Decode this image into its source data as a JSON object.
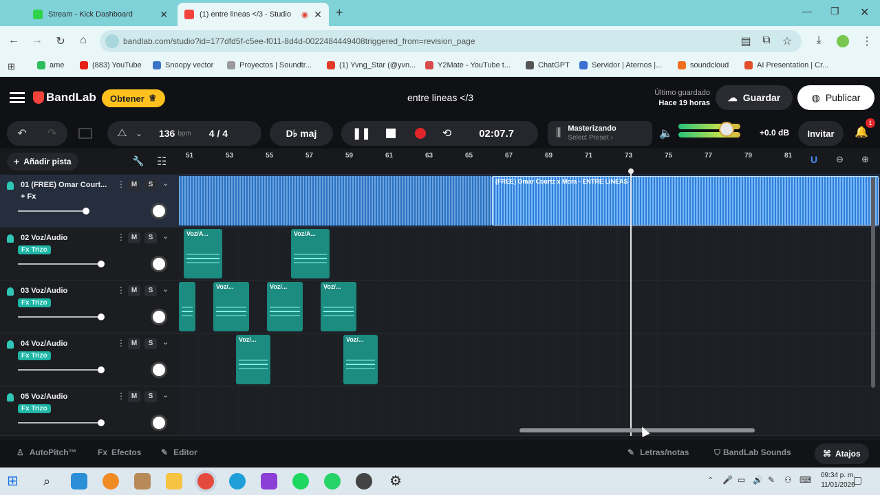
{
  "browser": {
    "tabs": [
      {
        "title": "Stream - Kick Dashboard",
        "color": "#2fd34a"
      },
      {
        "title": "(1) entre lineas </3 - Studio",
        "color": "#f2443b"
      }
    ],
    "new_tab": "+",
    "url": "bandlab.com/studio?id=177dfd5f-c5ee-f011-8d4d-0022484449408triggered_from=revision_page",
    "bookmarks": [
      {
        "label": "ame",
        "color": "#2fbf5a"
      },
      {
        "label": "(883) YouTube",
        "color": "#e62117"
      },
      {
        "label": "Snoopy vector",
        "color": "#3b74c6"
      },
      {
        "label": "Proyectos | Soundtr...",
        "color": "#9a9a9a"
      },
      {
        "label": "(1) Yvng_Star (@yvn...",
        "color": "#e23a2a"
      },
      {
        "label": "Y2Mate - YouTube t...",
        "color": "#d84a4a"
      },
      {
        "label": "ChatGPT",
        "color": "#555555"
      },
      {
        "label": "Servidor | Aternos |...",
        "color": "#3b6fd1"
      },
      {
        "label": "soundcloud",
        "color": "#f26f21"
      },
      {
        "label": "AI Presentation | Cr...",
        "color": "#e04e2a"
      }
    ]
  },
  "app": {
    "logo": "BandLab",
    "obtener": "Obtener",
    "project_title": "entre lineas </3",
    "saved_label": "Último guardado",
    "saved_time": "Hace 19 horas",
    "guardar": "Guardar",
    "publicar": "Publicar"
  },
  "transport": {
    "bpm": "136",
    "bpm_unit": "bpm",
    "time_signature": "4 / 4",
    "key": "D♭ maj",
    "position": "02:07.7",
    "mastering_title": "Masterizando",
    "mastering_sub": "Select Preset ›",
    "db": "+0.0 dB",
    "invitar": "Invitar",
    "notification_count": "1",
    "master_volume": 0.78
  },
  "tracks": {
    "add_track": "Añadir pista",
    "ruler": [
      "51",
      "53",
      "55",
      "57",
      "59",
      "61",
      "63",
      "65",
      "67",
      "69",
      "71",
      "73",
      "75",
      "77",
      "79",
      "81"
    ],
    "list": [
      {
        "name": "01 (FREE) Omar Court...",
        "fx": "+ Fx",
        "m": "M",
        "s": "S",
        "volume": 0.82
      },
      {
        "name": "02 Voz/Audio",
        "fx": "Fx Trizo",
        "m": "M",
        "s": "S",
        "volume": 0.98
      },
      {
        "name": "03 Voz/Audio",
        "fx": "Fx Trizo",
        "m": "M",
        "s": "S",
        "volume": 0.98
      },
      {
        "name": "04 Voz/Audio",
        "fx": "Fx Trizo",
        "m": "M",
        "s": "S",
        "volume": 0.98
      },
      {
        "name": "05 Voz/Audio",
        "fx": "Fx Trizo",
        "m": "M",
        "s": "S",
        "volume": 0.98
      }
    ],
    "beat_clip_label": "(FREE) Omar Courtz x Mora - ENTRE LINEAS",
    "vocal_clips": {
      "t2": [
        "Voz/A...",
        "Voz/A..."
      ],
      "t3": [
        "",
        "Voz/...",
        "Voz/...",
        "Voz/..."
      ],
      "t4": [
        "Voz/...",
        "Voz/..."
      ]
    }
  },
  "bottom": {
    "autopitch": "AutoPitch™",
    "efectos": "Efectos",
    "editor": "Editor",
    "letras": "Letras/notas",
    "sounds": "BandLab Sounds",
    "atajos": "Atajos"
  },
  "taskbar": {
    "time": "09:34 p. m.",
    "date": "11/01/2026"
  }
}
